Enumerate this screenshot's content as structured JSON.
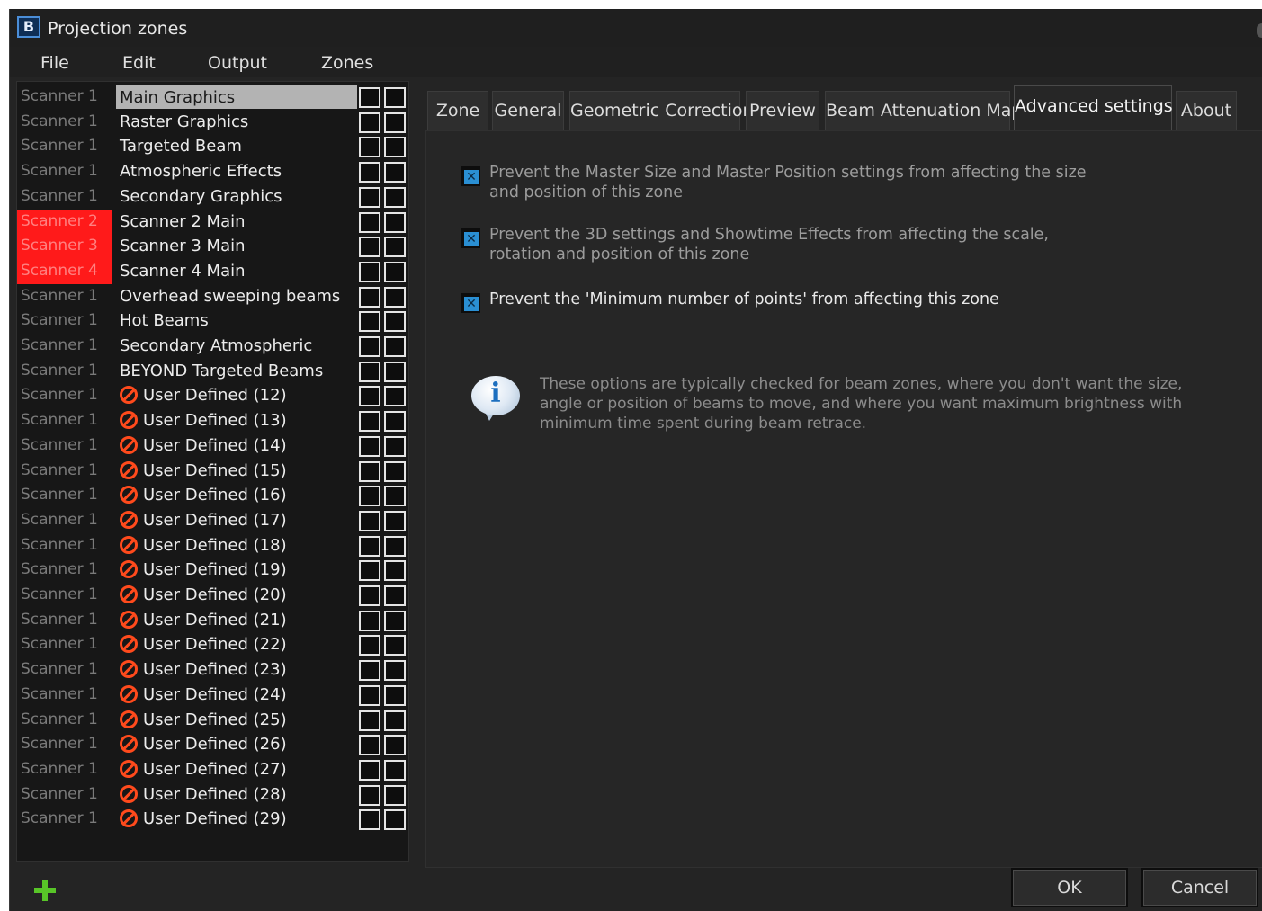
{
  "window": {
    "title": "Projection zones",
    "app_icon_letter": "B"
  },
  "menu": [
    "File",
    "Edit",
    "Output",
    "Zones"
  ],
  "zones": [
    {
      "scanner": "Scanner 1",
      "name": "Main Graphics",
      "selected": true
    },
    {
      "scanner": "Scanner 1",
      "name": "Raster Graphics"
    },
    {
      "scanner": "Scanner 1",
      "name": "Targeted Beam"
    },
    {
      "scanner": "Scanner 1",
      "name": "Atmospheric Effects"
    },
    {
      "scanner": "Scanner 1",
      "name": "Secondary Graphics"
    },
    {
      "scanner": "Scanner 2",
      "name": "Scanner 2 Main",
      "highlight": true
    },
    {
      "scanner": "Scanner 3",
      "name": "Scanner 3 Main",
      "highlight": true
    },
    {
      "scanner": "Scanner 4",
      "name": "Scanner 4 Main",
      "highlight": true
    },
    {
      "scanner": "Scanner 1",
      "name": "Overhead sweeping beams"
    },
    {
      "scanner": "Scanner 1",
      "name": "Hot Beams"
    },
    {
      "scanner": "Scanner 1",
      "name": "Secondary Atmospheric"
    },
    {
      "scanner": "Scanner 1",
      "name": "BEYOND Targeted Beams"
    },
    {
      "scanner": "Scanner 1",
      "name": "User Defined (12)",
      "disabled": true
    },
    {
      "scanner": "Scanner 1",
      "name": "User Defined (13)",
      "disabled": true
    },
    {
      "scanner": "Scanner 1",
      "name": "User Defined (14)",
      "disabled": true
    },
    {
      "scanner": "Scanner 1",
      "name": "User Defined (15)",
      "disabled": true
    },
    {
      "scanner": "Scanner 1",
      "name": "User Defined (16)",
      "disabled": true
    },
    {
      "scanner": "Scanner 1",
      "name": "User Defined (17)",
      "disabled": true
    },
    {
      "scanner": "Scanner 1",
      "name": "User Defined (18)",
      "disabled": true
    },
    {
      "scanner": "Scanner 1",
      "name": "User Defined (19)",
      "disabled": true
    },
    {
      "scanner": "Scanner 1",
      "name": "User Defined (20)",
      "disabled": true
    },
    {
      "scanner": "Scanner 1",
      "name": "User Defined (21)",
      "disabled": true
    },
    {
      "scanner": "Scanner 1",
      "name": "User Defined (22)",
      "disabled": true
    },
    {
      "scanner": "Scanner 1",
      "name": "User Defined (23)",
      "disabled": true
    },
    {
      "scanner": "Scanner 1",
      "name": "User Defined (24)",
      "disabled": true
    },
    {
      "scanner": "Scanner 1",
      "name": "User Defined (25)",
      "disabled": true
    },
    {
      "scanner": "Scanner 1",
      "name": "User Defined (26)",
      "disabled": true
    },
    {
      "scanner": "Scanner 1",
      "name": "User Defined (27)",
      "disabled": true
    },
    {
      "scanner": "Scanner 1",
      "name": "User Defined (28)",
      "disabled": true
    },
    {
      "scanner": "Scanner 1",
      "name": "User Defined (29)",
      "disabled": true
    }
  ],
  "tabs": [
    {
      "label": "Zone"
    },
    {
      "label": "General"
    },
    {
      "label": "Geometric Correction"
    },
    {
      "label": "Preview"
    },
    {
      "label": "Beam Attenuation Map"
    },
    {
      "label": "Advanced settings",
      "active": true
    },
    {
      "label": "About"
    }
  ],
  "advanced": {
    "options": [
      {
        "text": "Prevent the Master Size and Master Position settings from affecting the size and position of this zone",
        "checked": true
      },
      {
        "text": "Prevent the 3D settings and Showtime Effects from affecting the scale, rotation and position of this zone",
        "checked": true
      },
      {
        "text": "Prevent the 'Minimum number of points' from affecting this zone",
        "checked": true
      }
    ],
    "info_text": "These options are typically checked for beam zones, where you don't want the size, angle or position of beams to move, and where you want maximum brightness with minimum time spent during beam retrace."
  },
  "buttons": {
    "ok": "OK",
    "cancel": "Cancel"
  },
  "colors": {
    "window_bg": "#242424",
    "list_bg": "#171717",
    "scanner_highlight": "#ff1a1a",
    "selected_row": "#b3b3b3",
    "checkbox_mark": "#2a8fd3",
    "disabled_icon": "#ff4a1c",
    "add_icon": "#58c528"
  },
  "icons": {
    "app": "beyond-logo-icon",
    "add": "plus-icon",
    "disabled_zone": "forbidden-icon",
    "info": "info-bubble-icon",
    "checkbox": "checkbox-icon"
  }
}
